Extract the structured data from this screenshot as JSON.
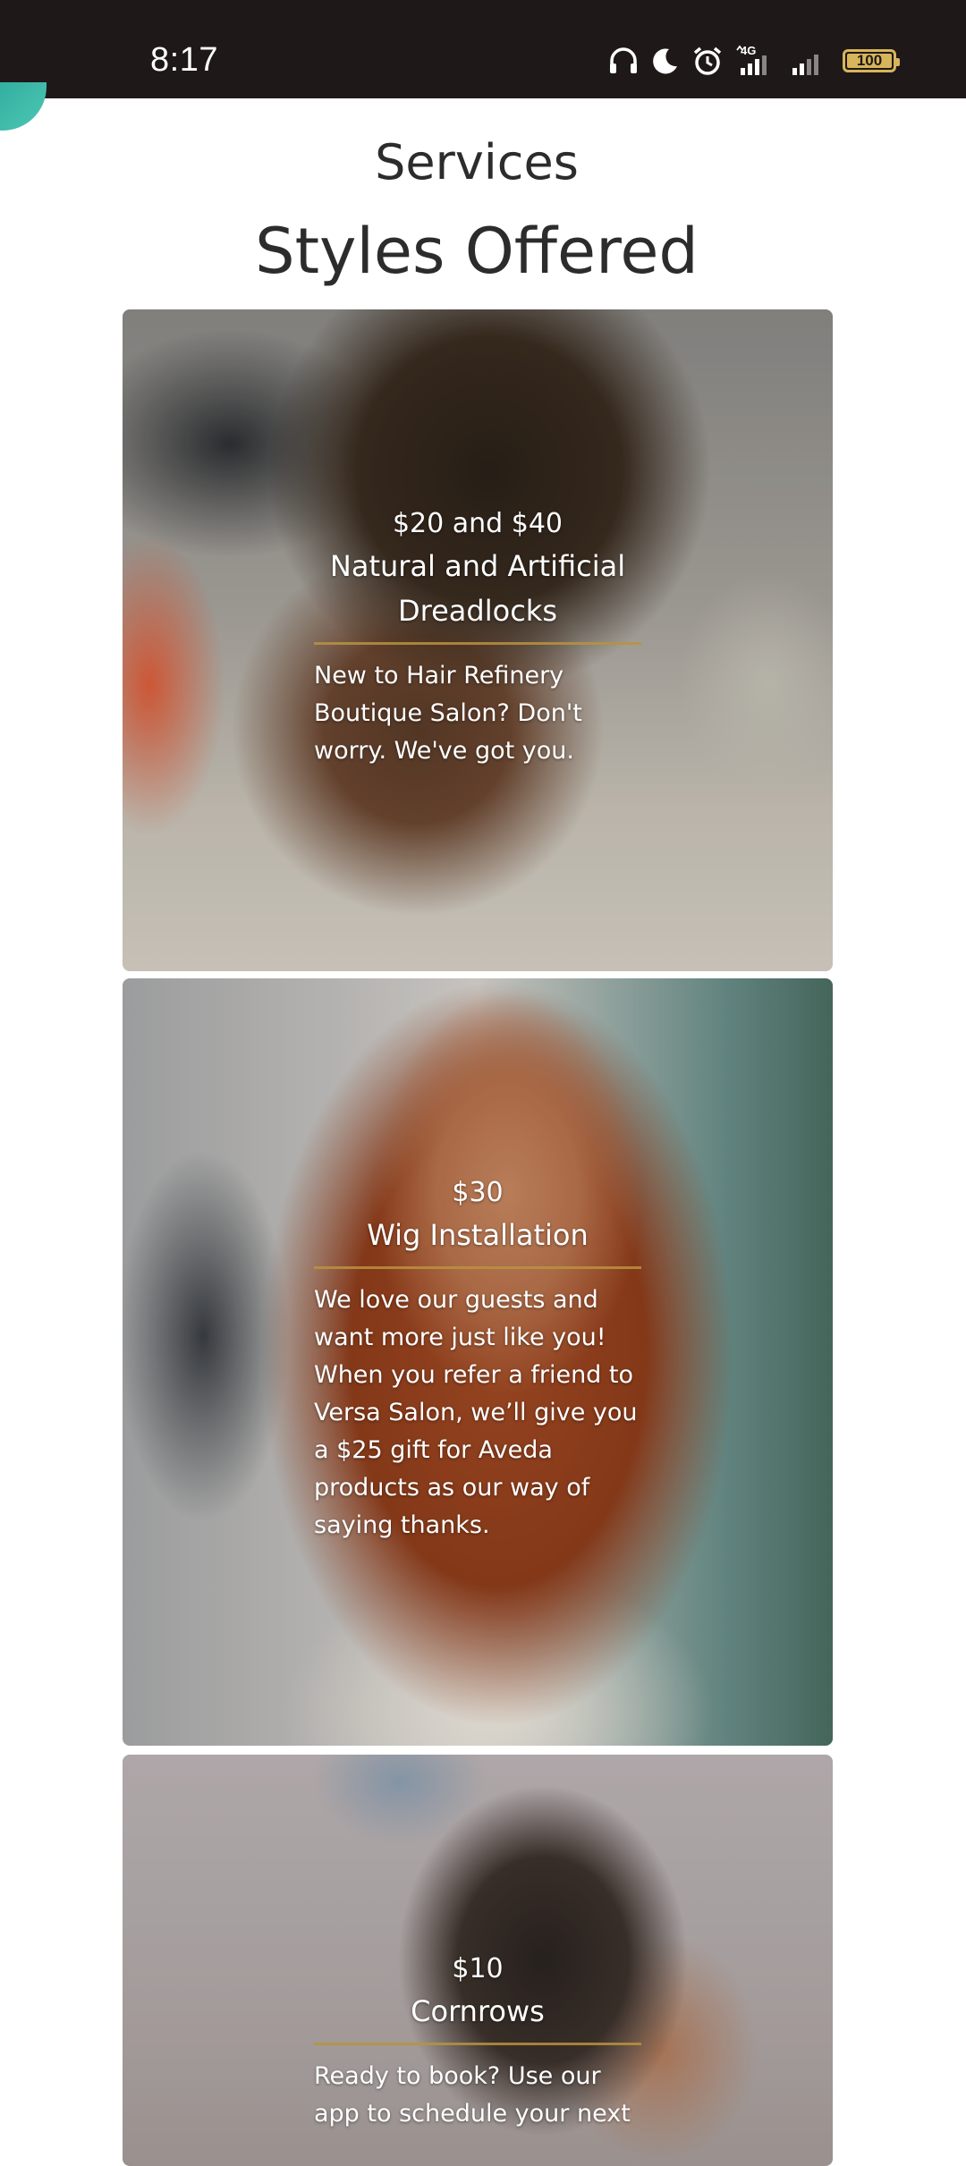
{
  "status_bar": {
    "time": "8:17",
    "network": "4G",
    "battery": "100",
    "icons": [
      "headphones-icon",
      "moon-icon",
      "alarm-icon",
      "signal-4g-icon",
      "signal-icon",
      "battery-icon"
    ]
  },
  "page": {
    "section_title": "Services",
    "heading": "Styles Offered"
  },
  "services": [
    {
      "price": "$20 and $40",
      "title": "Natural and Artificial Dreadlocks",
      "description": "New to Hair Refinery Boutique Salon? Don't worry. We've got you."
    },
    {
      "price": "$30",
      "title": "Wig Installation",
      "description": "We love our guests and want more just like you! When you refer a friend to Versa Salon, we’ll give you a  $25 gift  for Aveda products as our way of saying thanks."
    },
    {
      "price": "$10",
      "title": "Cornrows",
      "description": "Ready to book? Use our app to schedule your next"
    }
  ],
  "colors": {
    "status_bar_bg": "#1f1818",
    "accent_divider": "#b8923e",
    "teal_accent": "#2aa89a",
    "heading_text": "#2c2c2c"
  }
}
